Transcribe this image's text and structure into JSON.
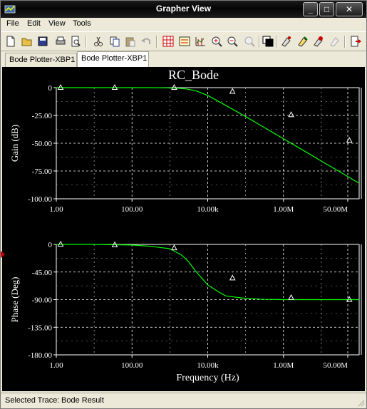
{
  "window": {
    "title": "Grapher View"
  },
  "menu": [
    "File",
    "Edit",
    "View",
    "Tools"
  ],
  "toolbar": {
    "icons": [
      "new-icon",
      "open-icon",
      "save-icon",
      "print-icon",
      "print-preview-icon",
      "cut-icon",
      "copy-icon",
      "paste-icon",
      "undo-icon",
      "grid-icon",
      "legend-icon",
      "cursor-icon",
      "zoom-in-icon",
      "zoom-out-icon",
      "zoom-fit-icon",
      "reverse-colors-icon",
      "trace-properties-icon",
      "select-marks-icon",
      "overlay-traces-icon",
      "add-trace-icon",
      "export-icon"
    ]
  },
  "tabs": [
    {
      "label": "Bode Plotter-XBP1",
      "active": false
    },
    {
      "label": "Bode Plotter-XBP1",
      "active": true
    }
  ],
  "status": {
    "label": "Selected Trace:",
    "value": "Bode Result"
  },
  "colors": {
    "plot_bg": "#000000",
    "trace": "#00ff00",
    "axis": "#ffffff",
    "grid": "#ffffff"
  },
  "chart_data": [
    {
      "type": "line",
      "title": "RC_Bode",
      "xlabel": "",
      "ylabel": "Gain (dB)",
      "xscale": "log",
      "xlim": [
        1,
        100000000
      ],
      "ylim": [
        -100,
        0
      ],
      "xticks": [
        1,
        100,
        10000,
        1000000,
        50000000
      ],
      "xtick_labels": [
        "1.00",
        "100.00",
        "10.00k",
        "1.00M",
        "50.00M"
      ],
      "yticks": [
        0,
        -25,
        -50,
        -75,
        -100
      ],
      "ytick_labels": [
        "0",
        "-25.00",
        "-50.00",
        "-75.00",
        "-100.00"
      ],
      "grid": true,
      "series": [
        {
          "x": [
            1,
            3,
            10,
            30,
            100,
            300,
            1000,
            2000,
            3000,
            5000,
            10000,
            30000,
            100000,
            300000,
            1000000,
            3000000,
            10000000,
            30000000,
            100000000
          ],
          "values": [
            0,
            0,
            0,
            0,
            0,
            0,
            -0.2,
            -0.7,
            -1.4,
            -3,
            -7,
            -16,
            -26,
            -35.5,
            -46,
            -55.5,
            -66,
            -75.5,
            -86
          ],
          "markers_x": [
            1.3,
            35,
            1300,
            45000,
            1600000,
            55000000
          ],
          "markers_y": [
            0,
            0,
            0,
            -3.5,
            -24.5,
            -47.5
          ]
        }
      ]
    },
    {
      "type": "line",
      "title": "",
      "xlabel": "Frequency (Hz)",
      "ylabel": "Phase (Deg)",
      "xscale": "log",
      "xlim": [
        1,
        100000000
      ],
      "ylim": [
        -180,
        0
      ],
      "xticks": [
        1,
        100,
        10000,
        1000000,
        50000000
      ],
      "xtick_labels": [
        "1.00",
        "100.00",
        "10.00k",
        "1.00M",
        "50.00M"
      ],
      "yticks": [
        0,
        -45,
        -90,
        -135,
        -180
      ],
      "ytick_labels": [
        "0",
        "-45.00",
        "-90.00",
        "-135.00",
        "-180.00"
      ],
      "grid": true,
      "series": [
        {
          "x": [
            1,
            10,
            100,
            300,
            1000,
            2000,
            3000,
            5000,
            10000,
            20000,
            30000,
            100000,
            300000,
            1000000,
            10000000,
            100000000
          ],
          "values": [
            0,
            0,
            -1,
            -3,
            -7,
            -17,
            -27,
            -45,
            -66,
            -78,
            -84,
            -88,
            -89.5,
            -90,
            -90,
            -90
          ],
          "markers_x": [
            1.3,
            35,
            1300,
            45000,
            1600000,
            55000000
          ],
          "markers_y": [
            0,
            -1,
            -6,
            -55,
            -87,
            -90
          ]
        }
      ]
    }
  ]
}
